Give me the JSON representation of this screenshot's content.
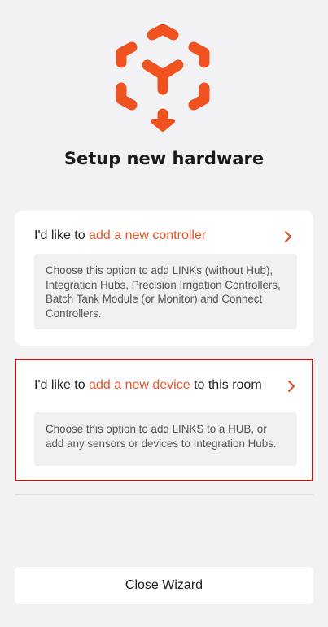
{
  "header": {
    "logo_icon": "hardware-cube-logo",
    "title": "Setup new hardware"
  },
  "options": [
    {
      "prefix": "I'd like to ",
      "accent": "add a new controller",
      "suffix": "",
      "icon": "chevron-right-icon",
      "description": "Choose this option to add LINKs (without Hub), Integration Hubs, Precision Irrigation Controllers, Batch Tank Module (or Monitor) and Connect Controllers."
    },
    {
      "prefix": "I'd like to ",
      "accent": "add a new device",
      "suffix": " to this room",
      "icon": "chevron-right-icon",
      "description": "Choose this option to add LINKS to a HUB, or add any sensors or devices to Integration Hubs."
    }
  ],
  "footer": {
    "close_label": "Close Wizard"
  },
  "colors": {
    "accent": "#e0542a",
    "highlight_border": "#b41c1c",
    "background": "#f2f2f4"
  }
}
